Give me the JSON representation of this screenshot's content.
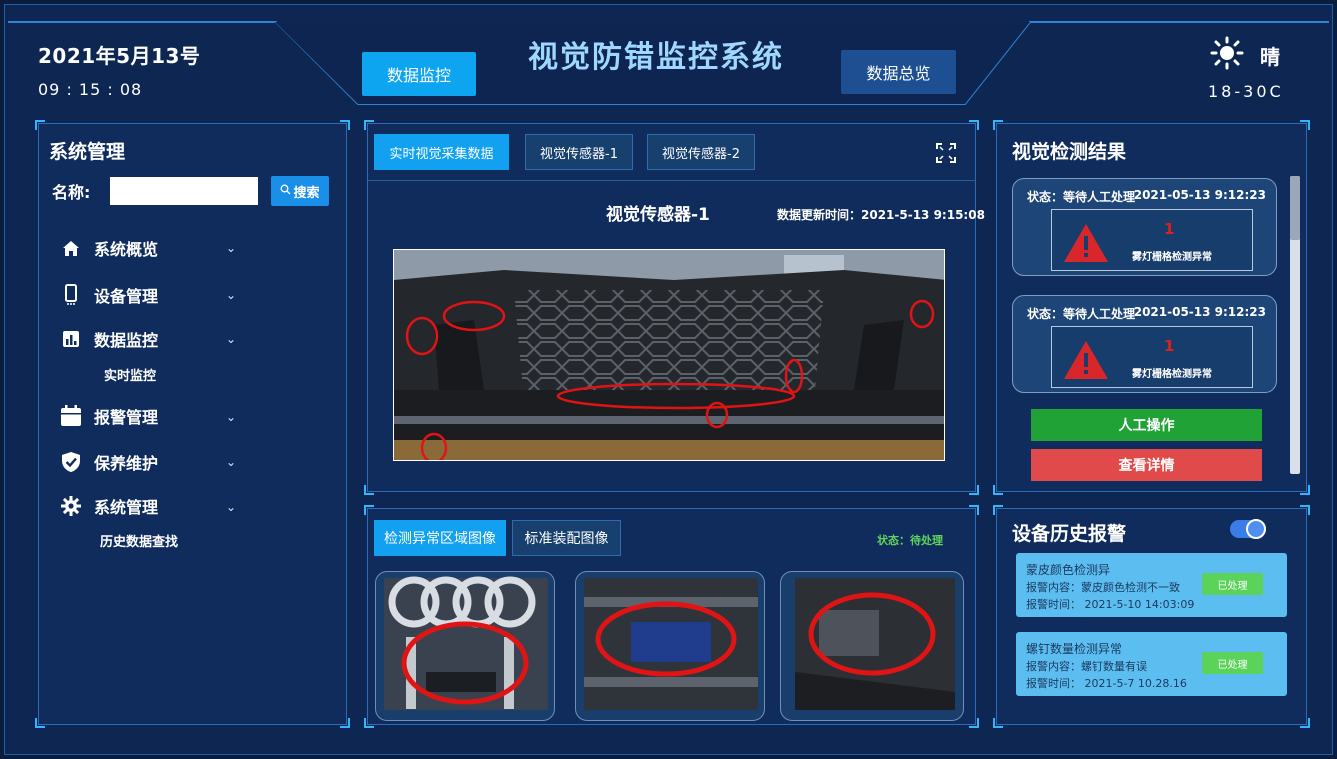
{
  "header": {
    "date": "2021年5月13号",
    "time": "09 : 15 : 08",
    "title": "视觉防错监控系统",
    "left_button": "数据监控",
    "right_button": "数据总览",
    "weather_icon": "sun-icon",
    "weather": "晴",
    "temperature": "18-30C"
  },
  "sidebar": {
    "title": "系统管理",
    "search_label": "名称:",
    "search_value": "",
    "search_button": "搜索",
    "items": [
      {
        "label": "系统概览",
        "icon": "home-icon"
      },
      {
        "label": "设备管理",
        "icon": "mobile-icon"
      },
      {
        "label": "数据监控",
        "icon": "bar-chart-icon"
      },
      {
        "label": "报警管理",
        "icon": "calendar-icon"
      },
      {
        "label": "保养维护",
        "icon": "shield-check-icon"
      },
      {
        "label": "系统管理",
        "icon": "gear-icon"
      }
    ],
    "sub_realtime": "实时监控",
    "sub_history": "历史数据查找"
  },
  "sensor_panel": {
    "tabs": [
      "实时视觉采集数据",
      "视觉传感器-1",
      "视觉传感器-2"
    ],
    "sensor_name": "视觉传感器-1",
    "update_time": "数据更新时间：2021-5-13 9:15:08"
  },
  "detail_panel": {
    "tabs": [
      "检测异常区域图像",
      "标准装配图像"
    ],
    "status": "状态：待处理"
  },
  "results": {
    "title": "视觉检测结果",
    "cards": [
      {
        "status": "状态：等待人工处理",
        "time": "2021-05-13 9:12:23",
        "count": "1",
        "message": "雾灯栅格检测异常"
      },
      {
        "status": "状态：等待人工处理",
        "time": "2021-05-13 9:12:23",
        "count": "1",
        "message": "雾灯栅格检测异常"
      }
    ],
    "manual_button": "人工操作",
    "detail_button": "查看详情",
    "colors": {
      "green": "#21a236",
      "red": "#e14a4a"
    }
  },
  "history": {
    "title": "设备历史报警",
    "toggle_on": true,
    "cards": [
      {
        "title": "蒙皮颜色检测异",
        "content": "报警内容：蒙皮颜色检测不一致",
        "time": "报警时间：  2021-5-10 14:03:09",
        "button": "已处理"
      },
      {
        "title": "螺钉数量检测异常",
        "content": "报警内容：螺钉数量有误",
        "time": "报警时间：  2021-5-7 10.28.16",
        "button": "已处理"
      }
    ]
  }
}
